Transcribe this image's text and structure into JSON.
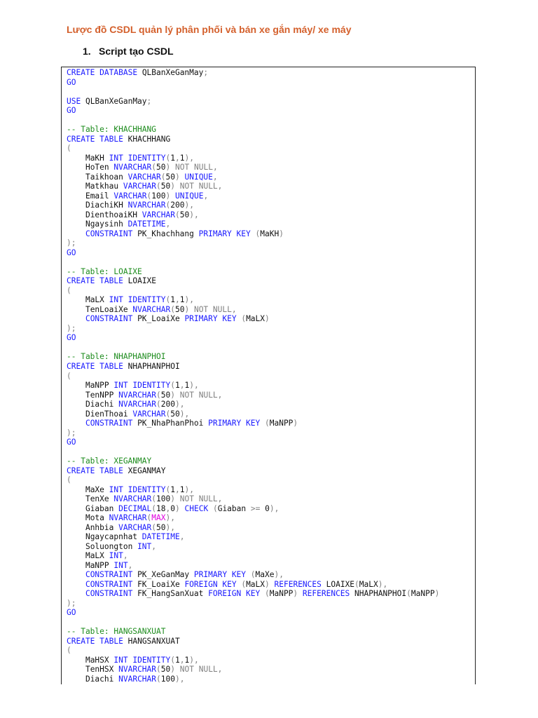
{
  "document": {
    "title": "Lược đồ CSDL quản lý phân phối và bán xe gắn máy/ xe máy",
    "section_number": "1.",
    "section_title": "Script tạo CSDL",
    "colors": {
      "title": "#d4602c",
      "keyword": "#1a1aff",
      "comment": "#1e8c1e",
      "punctuation": "#808080",
      "function": "#e000e0"
    },
    "code_lines": [
      "CREATE DATABASE QLBanXeGanMay;",
      "GO",
      "",
      "USE QLBanXeGanMay;",
      "GO",
      "",
      "-- Table: KHACHHANG",
      "CREATE TABLE KHACHHANG",
      "(",
      "    MaKH INT IDENTITY(1,1),",
      "    HoTen NVARCHAR(50) NOT NULL,",
      "    Taikhoan VARCHAR(50) UNIQUE,",
      "    Matkhau VARCHAR(50) NOT NULL,",
      "    Email VARCHAR(100) UNIQUE,",
      "    DiachiKH NVARCHAR(200),",
      "    DienthoaiKH VARCHAR(50),",
      "    Ngaysinh DATETIME,",
      "    CONSTRAINT PK_Khachhang PRIMARY KEY (MaKH)",
      ");",
      "GO",
      "",
      "-- Table: LOAIXE",
      "CREATE TABLE LOAIXE",
      "(",
      "    MaLX INT IDENTITY(1,1),",
      "    TenLoaiXe NVARCHAR(50) NOT NULL,",
      "    CONSTRAINT PK_LoaiXe PRIMARY KEY (MaLX)",
      ");",
      "GO",
      "",
      "-- Table: NHAPHANPHOI",
      "CREATE TABLE NHAPHANPHOI",
      "(",
      "    MaNPP INT IDENTITY(1,1),",
      "    TenNPP NVARCHAR(50) NOT NULL,",
      "    Diachi NVARCHAR(200),",
      "    DienThoai VARCHAR(50),",
      "    CONSTRAINT PK_NhaPhanPhoi PRIMARY KEY (MaNPP)",
      ");",
      "GO",
      "",
      "-- Table: XEGANMAY",
      "CREATE TABLE XEGANMAY",
      "(",
      "    MaXe INT IDENTITY(1,1),",
      "    TenXe NVARCHAR(100) NOT NULL,",
      "    Giaban DECIMAL(18,0) CHECK (Giaban >= 0),",
      "    Mota NVARCHAR(MAX),",
      "    Anhbia VARCHAR(50),",
      "    Ngaycapnhat DATETIME,",
      "    Soluongton INT,",
      "    MaLX INT,",
      "    MaNPP INT,",
      "    CONSTRAINT PK_XeGanMay PRIMARY KEY (MaXe),",
      "    CONSTRAINT FK_LoaiXe FOREIGN KEY (MaLX) REFERENCES LOAIXE(MaLX),",
      "    CONSTRAINT FK_HangSanXuat FOREIGN KEY (MaNPP) REFERENCES NHAPHANPHOI(MaNPP)",
      ");",
      "GO",
      "",
      "-- Table: HANGSANXUAT",
      "CREATE TABLE HANGSANXUAT",
      "(",
      "    MaHSX INT IDENTITY(1,1),",
      "    TenHSX NVARCHAR(50) NOT NULL,",
      "    Diachi NVARCHAR(100),"
    ]
  }
}
